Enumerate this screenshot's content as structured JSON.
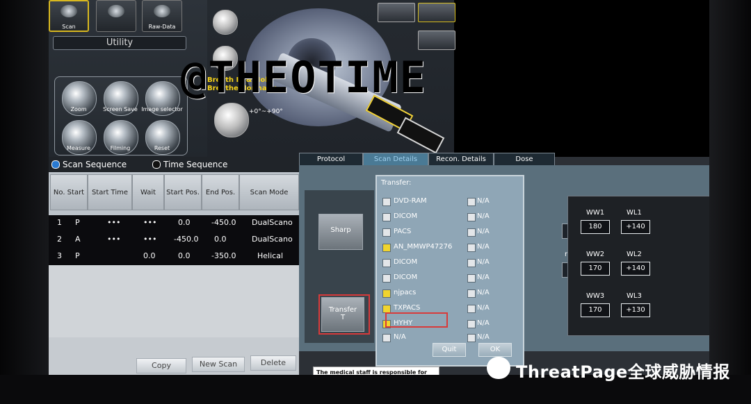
{
  "top_buttons": [
    "Scan",
    "Raw-Data"
  ],
  "utility_label": "Utility",
  "tools": [
    {
      "name": "zoom",
      "label": "Zoom"
    },
    {
      "name": "screen-save",
      "label": "Screen Save"
    },
    {
      "name": "image-selector",
      "label": "Image selector"
    },
    {
      "name": "measure",
      "label": "Measure"
    },
    {
      "name": "filming",
      "label": "Filming"
    },
    {
      "name": "reset",
      "label": "Reset"
    }
  ],
  "watermark": "@THEOTIME",
  "breath_text": [
    "Breath In & Hold",
    "Breathe Normally"
  ],
  "angle_text": "+0°~+90°",
  "scan_sequence_tabs": [
    "Scan Sequence",
    "Time Sequence"
  ],
  "table_headers": [
    "No. Start",
    "Start Time",
    "Wait",
    "Start Pos.",
    "End Pos.",
    "Scan Mode"
  ],
  "table_rows": [
    {
      "no": "1",
      "start": "P",
      "start_time": "•••",
      "wait": "•••",
      "start_pos": "0.0",
      "end_pos": "-450.0",
      "mode": "DualScano"
    },
    {
      "no": "2",
      "start": "A",
      "start_time": "•••",
      "wait": "•••",
      "start_pos": "-450.0",
      "end_pos": "0.0",
      "mode": "DualScano"
    },
    {
      "no": "3",
      "start": "P",
      "start_time": "",
      "wait": "0.0",
      "start_pos": "0.0",
      "end_pos": "-350.0",
      "mode": "Helical"
    }
  ],
  "bottom_buttons": [
    "Copy",
    "New Scan",
    "Delete"
  ],
  "tabs": [
    "Protocol",
    "Scan Details",
    "Recon. Details",
    "Dose"
  ],
  "left_side_buttons": {
    "sharp": "Sharp",
    "transfer_line1": "Transfer",
    "transfer_line2": "T"
  },
  "dialog": {
    "title": "Transfer:",
    "rows": [
      {
        "label": "DVD-RAM",
        "checked": false
      },
      {
        "label": "DICOM",
        "checked": false
      },
      {
        "label": "PACS",
        "checked": false
      },
      {
        "label": "AN_MMWP47276",
        "checked": true
      },
      {
        "label": "DICOM",
        "checked": false
      },
      {
        "label": "DICOM",
        "checked": false
      },
      {
        "label": "njpacs",
        "checked": true
      },
      {
        "label": "TXPACS",
        "checked": true
      },
      {
        "label": "HYHY",
        "checked": true
      },
      {
        "label": "N/A",
        "checked": false
      }
    ],
    "na_label": "N/A",
    "quit_label": "Quit",
    "ok_label": "OK"
  },
  "window_levels": [
    {
      "ww_label": "WW1",
      "ww": "180",
      "wl_label": "WL1",
      "wl": "+140"
    },
    {
      "ww_label": "WW2",
      "ww": "170",
      "wl_label": "WL2",
      "wl": "+140"
    },
    {
      "ww_label": "WW3",
      "ww": "170",
      "wl_label": "WL3",
      "wl": "+130"
    }
  ],
  "fragment_n": "n",
  "footer_text": "The medical staff is responsible for patient radiation exposure and safety.",
  "brand_text": "ThreatPage全球威胁情报"
}
